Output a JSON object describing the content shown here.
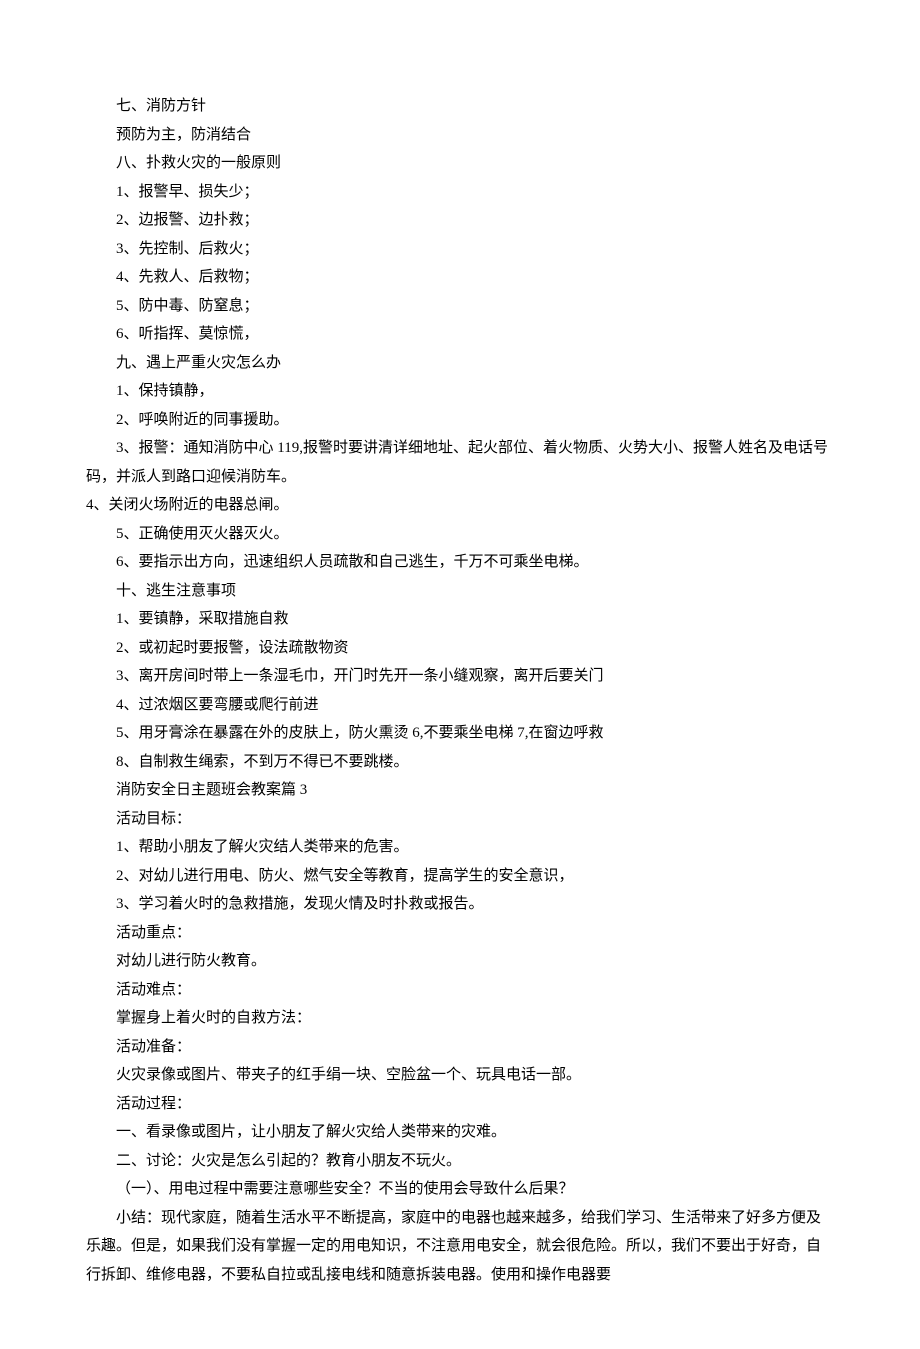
{
  "lines": [
    "七、消防方针",
    "预防为主，防消结合",
    "八、扑救火灾的一般原则",
    "1、报警早、损失少；",
    "2、边报警、边扑救；",
    "3、先控制、后救火；",
    "4、先救人、后救物；",
    "5、防中毒、防窒息；",
    "6、听指挥、莫惊慌，",
    "九、遇上严重火灾怎么办",
    "1、保持镇静，",
    "2、呼唤附近的同事援助。",
    "3、报警：通知消防中心 119,报警时要讲清详细地址、起火部位、着火物质、火势大小、报警人姓名及电话号码，并派人到路口迎候消防车。",
    "4、关闭火场附近的电器总闸。",
    "5、正确使用灭火器灭火。",
    "6、要指示出方向，迅速组织人员疏散和自己逃生，千万不可乘坐电梯。",
    "十、逃生注意事项",
    "1、要镇静，采取措施自救",
    "2、或初起时要报警，设法疏散物资",
    "3、离开房间时带上一条湿毛巾，开门时先开一条小缝观察，离开后要关门",
    "4、过浓烟区要弯腰或爬行前进",
    "5、用牙膏涂在暴露在外的皮肤上，防火熏烫 6,不要乘坐电梯 7,在窗边呼救",
    "8、自制救生绳索，不到万不得已不要跳楼。",
    "消防安全日主题班会教案篇 3",
    "活动目标：",
    "1、帮助小朋友了解火灾结人类带来的危害。",
    "2、对幼儿进行用电、防火、燃气安全等教育，提高学生的安全意识，",
    "3、学习着火时的急救措施，发现火情及时扑救或报告。",
    "活动重点：",
    "对幼儿进行防火教育。",
    "活动难点：",
    "掌握身上着火时的自救方法：",
    "活动准备：",
    "火灾录像或图片、带夹子的红手绢一块、空脸盆一个、玩具电话一部。",
    "活动过程：",
    "一、看录像或图片，让小朋友了解火灾给人类带来的灾难。",
    "二、讨论：火灾是怎么引起的？教育小朋友不玩火。",
    "（一）、用电过程中需要注意哪些安全？不当的使用会导致什么后果？",
    "小结：现代家庭，随着生活水平不断提高，家庭中的电器也越来越多，给我们学习、生活带来了好多方便及乐趣。但是，如果我们没有掌握一定的用电知识，不注意用电安全，就会很危险。所以，我们不要出于好奇，自行拆卸、维修电器，不要私自拉或乱接电线和随意拆装电器。使用和操作电器要"
  ],
  "noIndent": {
    "13": true,
    "39": true
  }
}
